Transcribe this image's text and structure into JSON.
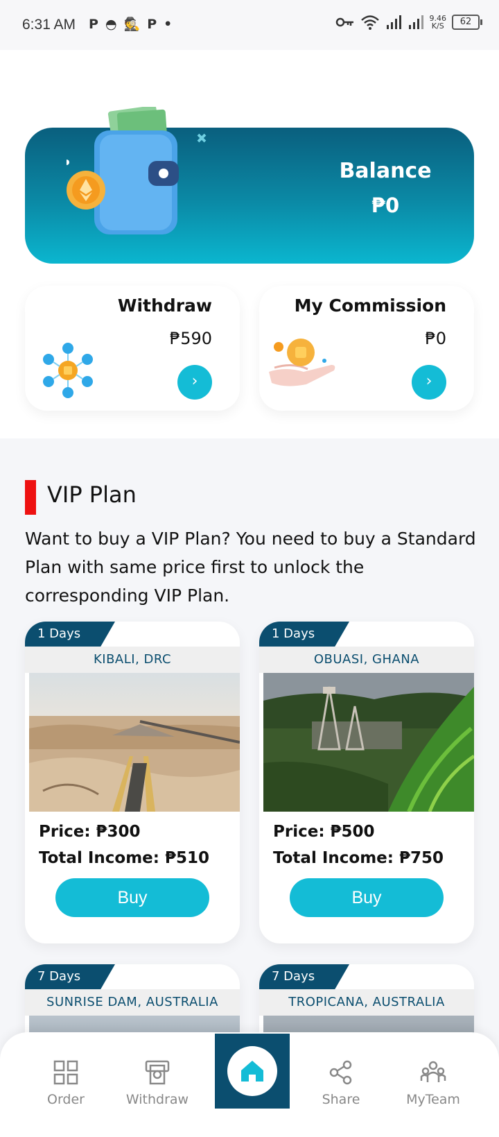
{
  "status_bar": {
    "time": "6:31 AM",
    "left_icons": [
      "P",
      "◓",
      "🕵",
      "P",
      "•"
    ],
    "speed_value": "9.46",
    "speed_unit": "K/S",
    "battery": "62"
  },
  "balance": {
    "title": "Balance",
    "value": "₱0"
  },
  "withdraw_card": {
    "title": "Withdraw",
    "value": "₱590"
  },
  "commission_card": {
    "title": "My Commission",
    "value": "₱0"
  },
  "vip": {
    "title": "VIP Plan",
    "description": "Want to buy a VIP Plan? You need to buy a Standard Plan with same price first to unlock the corresponding VIP Plan."
  },
  "plans": [
    {
      "days": "1 Days",
      "location": "KIBALI, DRC",
      "price": "Price: ₱300",
      "income": "Total Income: ₱510",
      "buy": "Buy"
    },
    {
      "days": "1 Days",
      "location": "OBUASI, GHANA",
      "price": "Price: ₱500",
      "income": "Total Income: ₱750",
      "buy": "Buy"
    },
    {
      "days": "7 Days",
      "location": "SUNRISE DAM, AUSTRALIA"
    },
    {
      "days": "7 Days",
      "location": "TROPICANA, AUSTRALIA"
    }
  ],
  "nav": {
    "order": "Order",
    "withdraw": "Withdraw",
    "share": "Share",
    "myteam": "MyTeam"
  },
  "colors": {
    "accent": "#14bcd6",
    "navy": "#0b4e6f",
    "vip_bar": "#ee1111"
  }
}
